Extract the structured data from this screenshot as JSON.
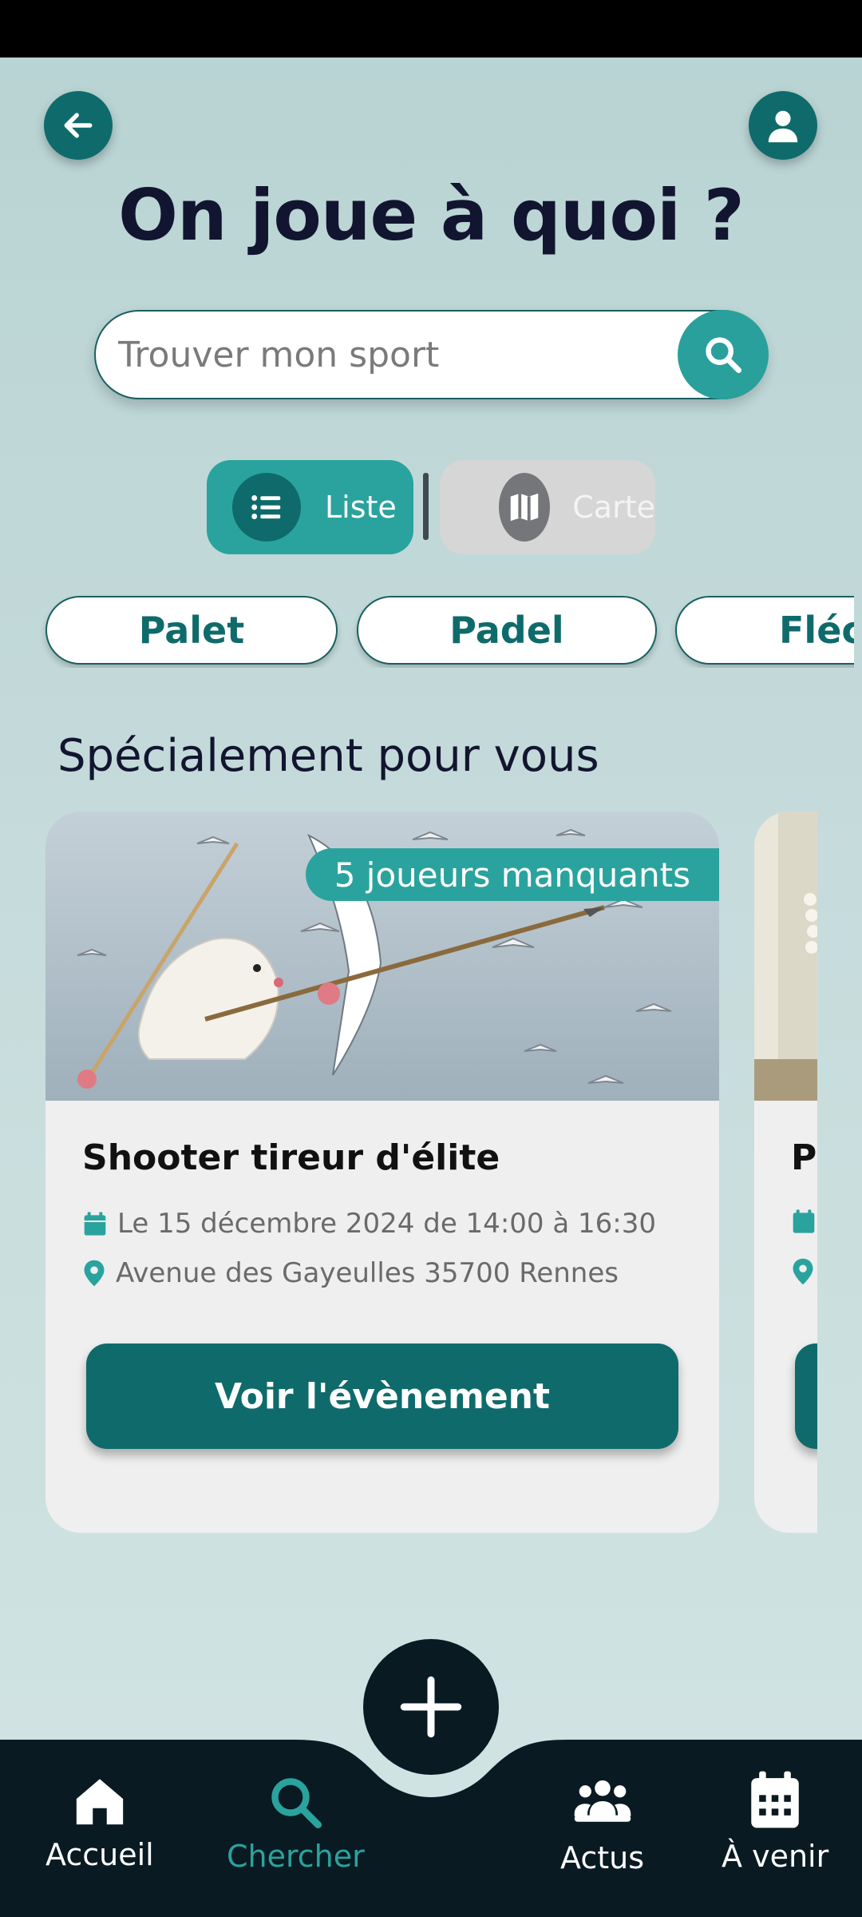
{
  "header": {
    "title": "On joue à quoi ?"
  },
  "search": {
    "placeholder": "Trouver mon sport"
  },
  "view_toggle": {
    "list_label": "Liste",
    "map_label": "Carte"
  },
  "sport_chips": [
    {
      "label": "Palet"
    },
    {
      "label": "Padel"
    },
    {
      "label": "Fléchettes"
    }
  ],
  "section": {
    "title": "Spécialement pour vous"
  },
  "cards": [
    {
      "badge": "5 joueurs manquants",
      "title": "Shooter tireur d'élite",
      "date": "Le 15 décembre 2024 de 14:00 à 16:30",
      "location": "Avenue des Gayeulles 35700 Rennes",
      "button": "Voir l'évènement"
    },
    {
      "title": "Pa"
    }
  ],
  "bottom_nav": [
    {
      "label": "Accueil",
      "icon": "home-icon"
    },
    {
      "label": "Chercher",
      "icon": "search-icon",
      "active": true
    },
    {
      "label": "Actus",
      "icon": "users-icon"
    },
    {
      "label": "À venir",
      "icon": "calendar-icon"
    }
  ],
  "colors": {
    "primary": "#0f6b6b",
    "accent": "#2aa39e",
    "nav_background": "#091a22",
    "title": "#121530"
  }
}
